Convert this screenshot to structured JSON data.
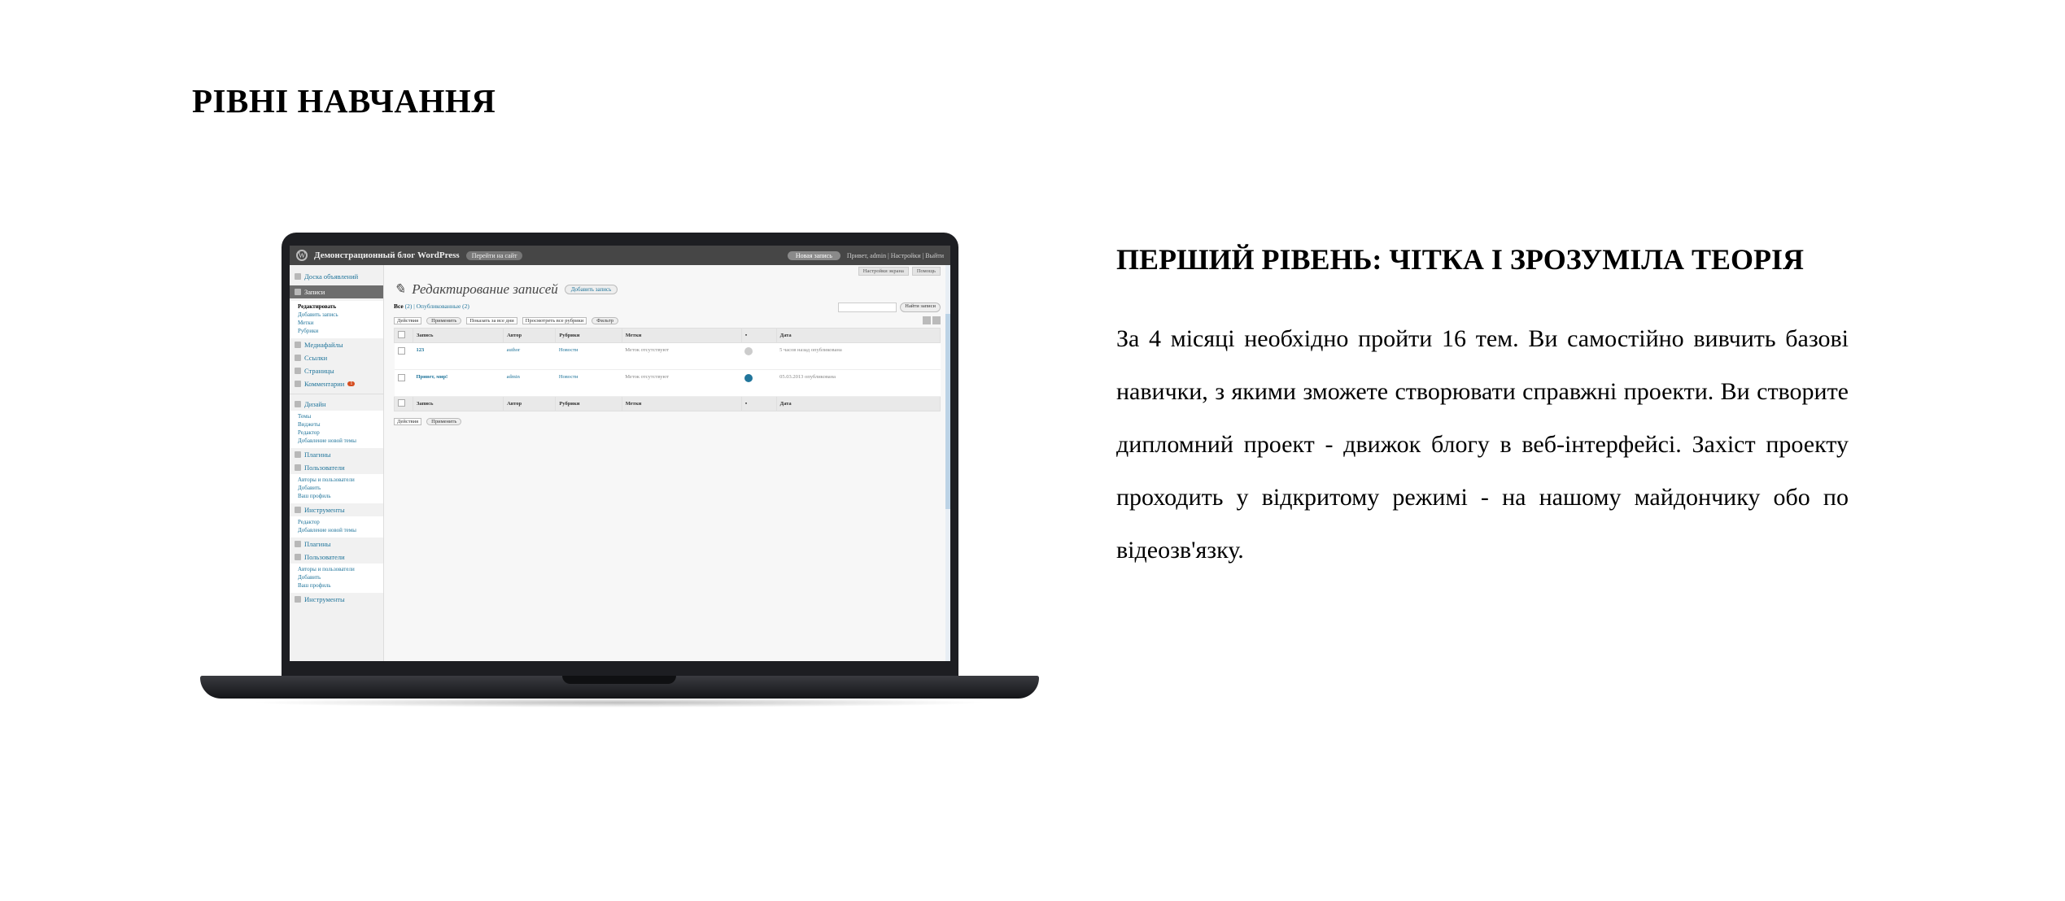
{
  "heading": "РІВНІ НАВЧАННЯ",
  "level": {
    "title": "ПЕРШИЙ РІВЕНЬ: ЧІТКА І ЗРОЗУМІЛА ТЕОРІЯ",
    "description": "За 4 місяці необхідно пройти 16 тем. Ви самостійно вивчить базові навички, з якими зможете створювати справжні проекти. Ви створите дипломний проект - движок блогу в веб-інтерфейсі. Захіст проекту проходить у відкритому режимі - на нашому майдончику обо по відеозв'язку."
  },
  "laptop_screen": {
    "site_name": "Демонстрационный блог WordPress",
    "site_pill": "Перейти на сайт",
    "new_post": "Новая запись",
    "user_links": "Привет, admin | Настройки | Выйти",
    "screen_options": [
      "Настройки экрана",
      "Помощь"
    ],
    "sidebar": {
      "dashboard": "Доска объявлений",
      "posts": "Записи",
      "posts_sub": [
        "Редактировать",
        "Добавить запись",
        "Метки",
        "Рубрики"
      ],
      "media": "Медиафайлы",
      "links": "Ссылки",
      "pages": "Страницы",
      "comments": "Комментарии",
      "comments_badge": "1",
      "appearance": "Дизайн",
      "appearance_sub": [
        "Темы",
        "Виджеты",
        "Редактор",
        "Добавление новой темы"
      ],
      "plugins": "Плагины",
      "users": "Пользователи",
      "users_sub": [
        "Авторы и пользователи",
        "Добавить",
        "Ваш профиль"
      ],
      "tools": "Инструменты",
      "tools_sub": [
        "Редактор",
        "Добавление новой темы"
      ],
      "plugins2": "Плагины",
      "users2": "Пользователи",
      "users2_sub": [
        "Авторы и пользователи",
        "Добавить",
        "Ваш профиль"
      ],
      "tools2": "Инструменты"
    },
    "page_title": "Редактирование записей",
    "add_new": "Добавить запись",
    "filters": "Все (2) | Опубликованные (2)",
    "filters_all": "Все",
    "filters_rest": "(2) | Опубликованные (2)",
    "search_button": "Найти записи",
    "bulk_action": "Действия",
    "apply": "Применить",
    "show_dates": "Показать за все дни",
    "show_cats": "Просмотреть все рубрики",
    "filter_btn": "Фильтр",
    "columns": [
      "Запись",
      "Автор",
      "Рубрики",
      "Метки",
      "",
      "Дата"
    ],
    "rows": [
      {
        "title": "123",
        "author": "author",
        "cat": "Новости",
        "tags": "Меток отсутствуют",
        "date": "5 часов назад опубликована"
      },
      {
        "title": "Привет, мир!",
        "author": "admin",
        "cat": "Новости",
        "tags": "Меток отсутствуют",
        "date": "05.03.2013 опубликована"
      }
    ]
  }
}
